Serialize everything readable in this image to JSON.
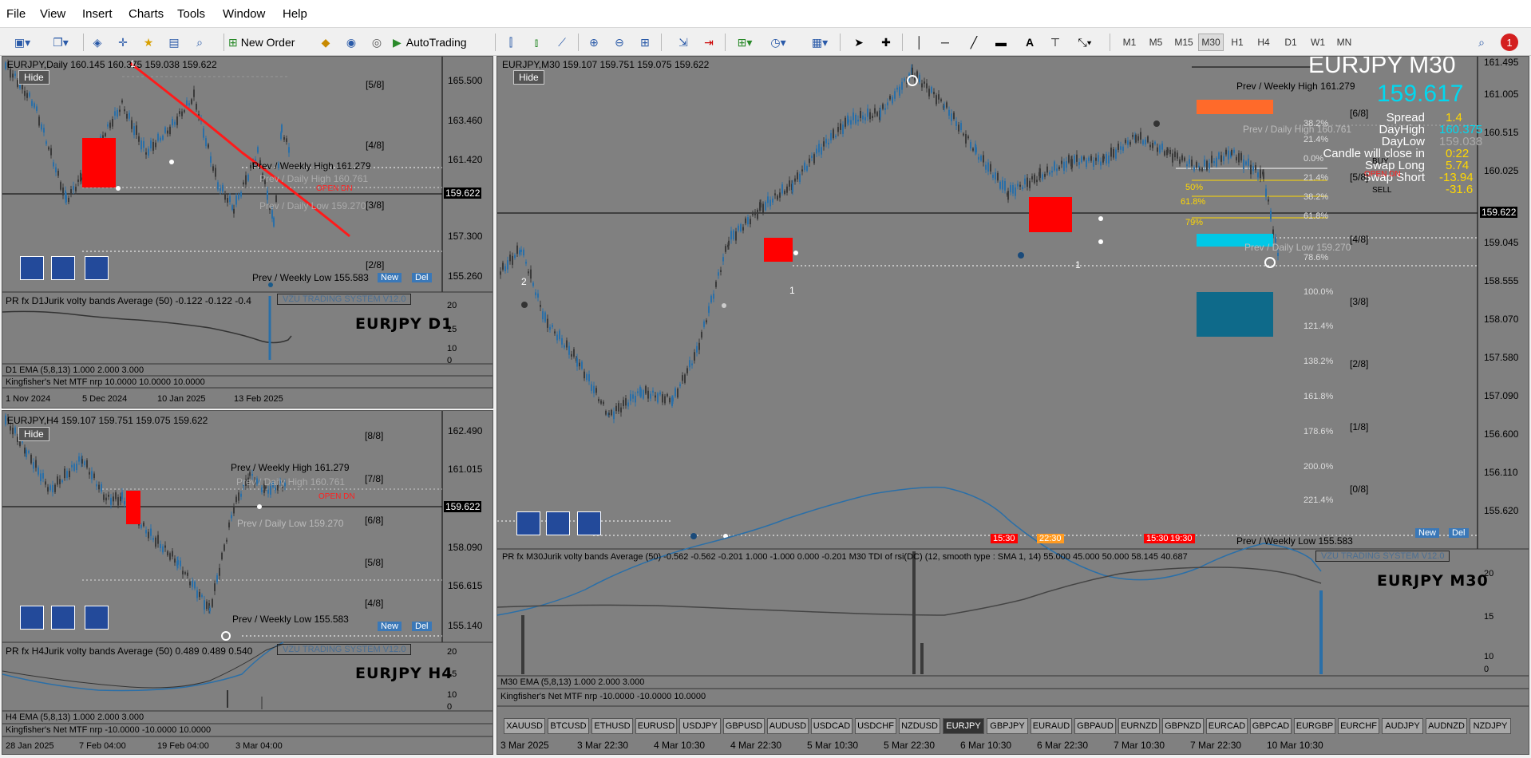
{
  "menu": [
    "File",
    "View",
    "Insert",
    "Charts",
    "Tools",
    "Window",
    "Help"
  ],
  "toolbar": {
    "new_order": "New Order",
    "autotrading": "AutoTrading",
    "timeframes": [
      "M1",
      "M5",
      "M15",
      "M30",
      "H1",
      "H4",
      "D1",
      "W1",
      "MN"
    ],
    "active_tf": "M30",
    "notif": "1"
  },
  "d1": {
    "caption": "EURJPY,Daily  160.145 160.375 159.038 159.622",
    "hide": "Hide",
    "symbol": "EURJPY  D1",
    "wave": "1",
    "prices": [
      "165.500",
      "163.460",
      "161.420",
      "159.622",
      "157.300",
      "155.260"
    ],
    "murrey": [
      "[5/8]",
      "[4/8]",
      "[3/8]",
      "[2/8]"
    ],
    "weekly_high": "Prev / Weekly High 161.279",
    "daily_high": "Prev / Daily High 160.761",
    "open_dn": "OPEN  DN",
    "daily_low": "Prev / Daily Low 159.270",
    "weekly_low": "Prev / Weekly Low 155.583",
    "ind1": "PR fx  D1Jurik volty bands Average (50) -0.122 -0.122 -0.4",
    "ind1_scale": [
      "20",
      "15",
      "10",
      "0"
    ],
    "ema": "D1 EMA (5,8,13) 1.000 2.000 3.000",
    "kf": "Kingfisher's Net MTF nrp 10.0000 10.0000 10.0000",
    "dates": [
      "1 Nov 2024",
      "5 Dec 2024",
      "10 Jan 2025",
      "13 Feb 2025"
    ]
  },
  "h4": {
    "caption": "EURJPY,H4  159.107 159.751 159.075 159.622",
    "hide": "Hide",
    "symbol": "EURJPY  H4",
    "prices": [
      "162.490",
      "161.015",
      "159.622",
      "158.090",
      "156.615",
      "155.140"
    ],
    "murrey": [
      "[8/8]",
      "[7/8]",
      "[6/8]",
      "[5/8]",
      "[4/8]"
    ],
    "weekly_high": "Prev / Weekly High 161.279",
    "daily_high": "Prev / Daily High 160.761",
    "open_dn": "OPEN  DN",
    "daily_low": "Prev / Daily Low 159.270",
    "weekly_low": "Prev / Weekly Low 155.583",
    "ind1": "PR fx  H4Jurik volty bands Average (50) 0.489 0.489 0.540",
    "ind1_scale": [
      "20",
      "15",
      "10",
      "0"
    ],
    "ema": "H4 EMA (5,8,13) 1.000 2.000 3.000",
    "kf": "Kingfisher's Net MTF nrp -10.0000 -10.0000 10.0000",
    "dates": [
      "28 Jan 2025",
      "7 Feb 04:00",
      "19 Feb 04:00",
      "3 Mar 04:00"
    ]
  },
  "m30": {
    "caption": "EURJPY,M30  159.107 159.751 159.075 159.622",
    "hide": "Hide",
    "symbol": "EURJPY  M30",
    "title": "EURJPY M30",
    "bid": "159.617",
    "info": [
      [
        "Spread",
        "1.4"
      ],
      [
        "DayHigh",
        "160.375"
      ],
      [
        "DayLow",
        "159.038"
      ],
      [
        "Candle will close in",
        "0:22"
      ],
      [
        "Swap Long",
        "5.74"
      ],
      [
        "Swap Short",
        "-13.94"
      ],
      [
        "",
        "-31.6"
      ]
    ],
    "prices": [
      "161.495",
      "161.005",
      "160.515",
      "160.025",
      "159.622",
      "159.045",
      "158.555",
      "158.070",
      "157.580",
      "157.090",
      "156.600",
      "156.110",
      "155.620"
    ],
    "murrey": [
      "[6/8]",
      "[5/8]",
      "[4/8]",
      "[3/8]",
      "[2/8]",
      "[1/8]",
      "[0/8]"
    ],
    "fib": [
      "38.2%",
      "21.4%",
      "0.0%",
      "21.4%",
      "38.2%",
      "61.8%",
      "78.6%",
      "100.0%",
      "121.4%",
      "138.2%",
      "161.8%",
      "178.6%",
      "200.0%",
      "221.4%"
    ],
    "fib_inner": [
      "50%",
      "61.8%",
      "79%"
    ],
    "buy": "BUY",
    "sell": "SELL",
    "open_dn": "OPEN  DN",
    "weekly_high": "Prev / Weekly High 161.279",
    "daily_high": "Prev / Daily High 160.761",
    "daily_low": "Prev / Daily Low 159.270",
    "weekly_low": "Prev / Weekly Low 155.583",
    "sessions": [
      "15:30",
      "22:30",
      "15:30",
      "19:30"
    ],
    "waves": [
      "2",
      "1",
      "1"
    ],
    "ind1": "PR fx  M30Jurik volty bands Average (50) -0.562 -0.562 -0.201 1.000 -1.000 0.000 -0.201  M30 TDI of rsi(DC)  (12, smooth type :  SMA 1, 14) 55.000 45.000 50.000 58.145 40.687",
    "ind1_scale": [
      "20",
      "15",
      "10",
      "0"
    ],
    "ema": "M30 EMA (5,8,13) 1.000 2.000 3.000",
    "kf": "Kingfisher's Net MTF nrp -10.0000 -10.0000 10.0000",
    "dates": [
      "3 Mar 2025",
      "3 Mar 22:30",
      "4 Mar 10:30",
      "4 Mar 22:30",
      "5 Mar 10:30",
      "5 Mar 22:30",
      "6 Mar 10:30",
      "6 Mar 22:30",
      "7 Mar 10:30",
      "7 Mar 22:30",
      "10 Mar 10:30"
    ],
    "symbols": [
      "XAUUSD",
      "BTCUSD",
      "ETHUSD",
      "EURUSD",
      "USDJPY",
      "GBPUSD",
      "AUDUSD",
      "USDCAD",
      "USDCHF",
      "NZDUSD",
      "EURJPY",
      "GBPJPY",
      "EURAUD",
      "GBPAUD",
      "EURNZD",
      "GBPNZD",
      "EURCAD",
      "GBPCAD",
      "EURGBP",
      "EURCHF",
      "AUDJPY",
      "AUDNZD",
      "NZDJPY"
    ]
  },
  "vzu": "VZU TRADING SYSTEM V12.0",
  "new": "New",
  "del": "Del",
  "colors": {
    "bg": "#808080",
    "bull": "#2a6fa8",
    "bear": "#3a3a3a",
    "red": "#ff0000",
    "yellow": "#ffd700",
    "cyan": "#00c8e6",
    "teal": "#0e6a8a",
    "orange": "#ff6a2a"
  }
}
